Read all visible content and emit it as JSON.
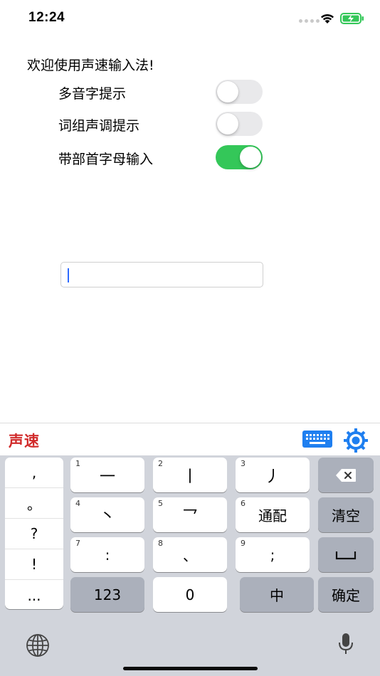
{
  "status_bar": {
    "time": "12:24"
  },
  "settings": {
    "welcome": "欢迎使用声速输入法!",
    "items": [
      {
        "label": "多音字提示",
        "on": false
      },
      {
        "label": "词组声调提示",
        "on": false
      },
      {
        "label": "带部首字母输入",
        "on": true
      }
    ]
  },
  "input": {
    "value": ""
  },
  "keyboard": {
    "brand": "声速",
    "punctuation": [
      ",",
      "。",
      "?",
      "!",
      "..."
    ],
    "keys": {
      "k1": {
        "num": "1",
        "label": "一"
      },
      "k2": {
        "num": "2",
        "label": "丨"
      },
      "k3": {
        "num": "3",
        "label": "丿"
      },
      "k4": {
        "num": "4",
        "label": "丶"
      },
      "k5": {
        "num": "5",
        "label": "乛"
      },
      "k6": {
        "num": "6",
        "label": "通配"
      },
      "k7": {
        "num": "7",
        "label": ":"
      },
      "k8": {
        "num": "8",
        "label": "、"
      },
      "k9": {
        "num": "9",
        "label": ";"
      },
      "clear": "清空",
      "num123": "123",
      "zero": "0",
      "zhong": "中",
      "confirm": "确定"
    },
    "icons": {
      "keyboard": "keyboard-icon",
      "settings": "gear-icon",
      "backspace": "backspace-icon",
      "space": "space-icon",
      "globe": "globe-icon",
      "mic": "microphone-icon"
    },
    "colors": {
      "brand": "#d12a2a",
      "accent": "#1f7ff0",
      "toggle_on": "#34c759"
    }
  }
}
